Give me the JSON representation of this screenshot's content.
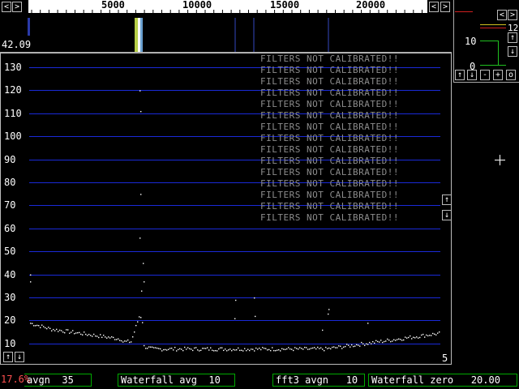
{
  "frequency_axis": {
    "tick_labels": [
      "5000",
      "10000",
      "15000",
      "20000"
    ],
    "arrows": [
      "<",
      ">",
      "<",
      ">",
      "<"
    ]
  },
  "waterfall": {
    "level_label": "42.09"
  },
  "spectrum": {
    "y_ticks": [
      "130",
      "120",
      "110",
      "100",
      "90",
      "80",
      "70",
      "60",
      "50",
      "40",
      "30",
      "20",
      "10"
    ],
    "warning_text": "FILTERS NOT CALIBRATED!!",
    "warning_repeat": 15,
    "corner_label": "5",
    "colors": {
      "grid": "#1a2ad8",
      "trace": "#ffffff",
      "warning": "#8c8c8c"
    }
  },
  "side_panel": {
    "scale_label_top": "12",
    "scale_label_mid": "10",
    "scale_label_bottom": "0",
    "buttons": [
      "↑",
      "↓",
      "-",
      "+",
      "o"
    ]
  },
  "status_bar": {
    "cpu": "17.6%",
    "avgn": "avgn  35",
    "waterfall_avg": "Waterfall avg  10",
    "fft3_avgn": "fft3 avgn   10",
    "waterfall_zero": "Waterfall zero   20.00"
  },
  "icons": [
    "left-arrow-icon",
    "right-arrow-icon",
    "up-arrow-icon",
    "down-arrow-icon",
    "crosshair-icon"
  ]
}
